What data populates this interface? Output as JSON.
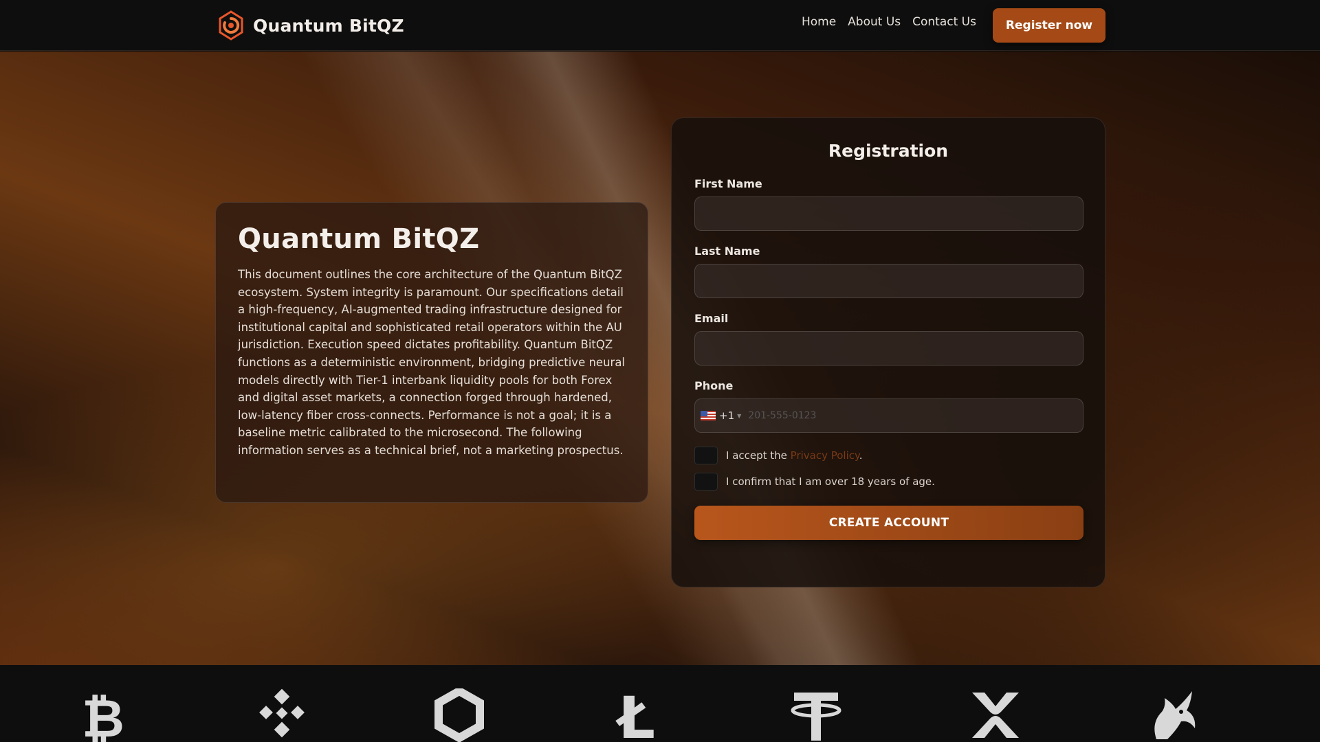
{
  "header": {
    "brand_name": "Quantum BitQZ",
    "nav": [
      "Home",
      "About Us",
      "Contact Us"
    ],
    "register_label": "Register now"
  },
  "info": {
    "title": "Quantum BitQZ",
    "body": "This document outlines the core architecture of the Quantum BitQZ ecosystem. System integrity is paramount. Our specifications detail a high-frequency, AI-augmented trading infrastructure designed for institutional capital and sophisticated retail operators within the AU jurisdiction. Execution speed dictates profitability. Quantum BitQZ functions as a deterministic environment, bridging predictive neural models directly with Tier-1 interbank liquidity pools for both Forex and digital asset markets, a connection forged through hardened, low-latency fiber cross-connects. Performance is not a goal; it is a baseline metric calibrated to the microsecond. The following information serves as a technical brief, not a marketing prospectus."
  },
  "registration": {
    "title": "Registration",
    "first_name_label": "First Name",
    "last_name_label": "Last Name",
    "email_label": "Email",
    "phone_label": "Phone",
    "phone_dial_code": "+1",
    "phone_placeholder": "201-555-0123",
    "privacy_prefix": "I accept the ",
    "privacy_link": "Privacy Policy",
    "privacy_suffix": ".",
    "age_label": "I confirm that I am over 18 years of age.",
    "submit_label": "CREATE ACCOUNT"
  },
  "coins": [
    "bitcoin-icon",
    "binance-icon",
    "chainlink-icon",
    "litecoin-icon",
    "tether-icon",
    "xrp-icon",
    "uniswap-icon"
  ],
  "colors": {
    "accent": "#a54a16",
    "background": "#0e0e0e"
  }
}
